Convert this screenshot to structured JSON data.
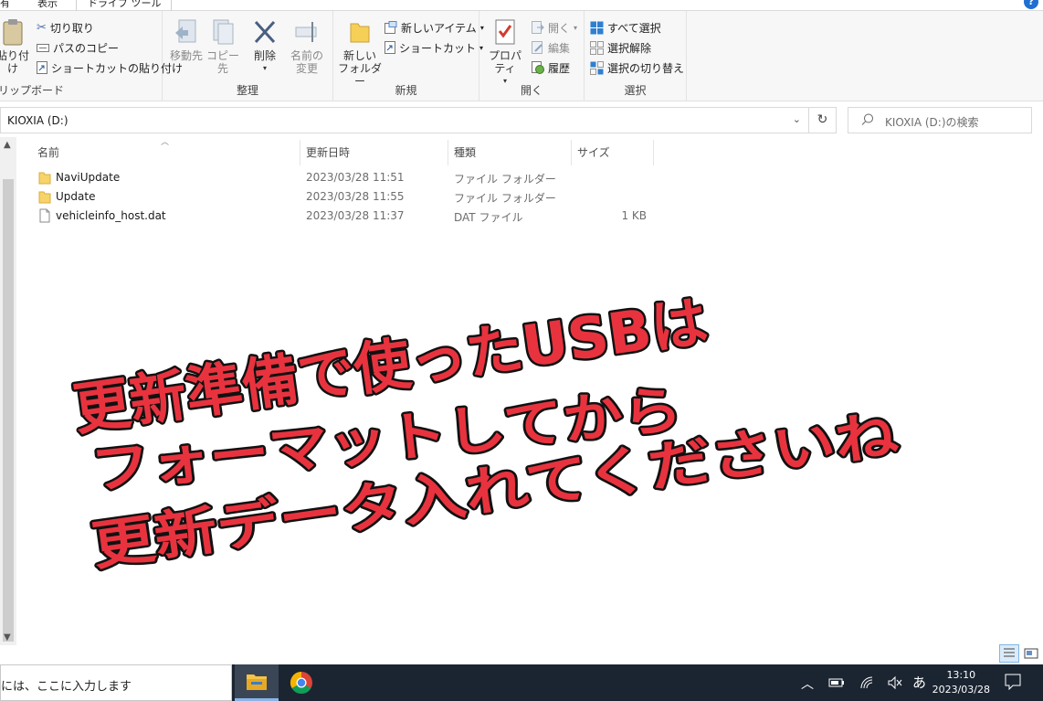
{
  "tabs": {
    "file": "有",
    "view": "表示",
    "drive_tools": "ドライブ ツール"
  },
  "ribbon": {
    "clipboard": {
      "label": "リップボード",
      "paste": "貼り付け",
      "cut": "切り取り",
      "copy_path": "パスのコピー",
      "paste_shortcut": "ショートカットの貼り付け"
    },
    "organize": {
      "label": "整理",
      "move_to": "移動先",
      "copy_to": "コピー先",
      "delete": "削除",
      "rename_1": "名前の",
      "rename_2": "変更"
    },
    "new": {
      "label": "新規",
      "new_folder_1": "新しい",
      "new_folder_2": "フォルダー",
      "new_item": "新しいアイテム",
      "shortcut": "ショートカット"
    },
    "open": {
      "label": "開く",
      "properties": "プロパティ",
      "open": "開く",
      "edit": "編集",
      "history": "履歴"
    },
    "select": {
      "label": "選択",
      "select_all": "すべて選択",
      "select_none": "選択解除",
      "invert": "選択の切り替え"
    }
  },
  "address": {
    "path": "KIOXIA (D:)",
    "search_placeholder": "KIOXIA (D:)の検索"
  },
  "columns": {
    "name": "名前",
    "modified": "更新日時",
    "type": "種類",
    "size": "サイズ"
  },
  "files": [
    {
      "name": "NaviUpdate",
      "modified": "2023/03/28 11:51",
      "type": "ファイル フォルダー",
      "size": "",
      "icon": "folder-icon"
    },
    {
      "name": "Update",
      "modified": "2023/03/28 11:55",
      "type": "ファイル フォルダー",
      "size": "",
      "icon": "folder-icon"
    },
    {
      "name": "vehicleinfo_host.dat",
      "modified": "2023/03/28 11:37",
      "type": "DAT ファイル",
      "size": "1 KB",
      "icon": "file-icon"
    }
  ],
  "overlay": {
    "line1": "更新準備で使ったUSBは",
    "line2": "フォーマットしてから",
    "line3": "更新データ入れてくださいね",
    "fill_color": "#e8333f",
    "outline_color": "#111111"
  },
  "taskbar": {
    "search_text": "には、ここに入力します",
    "ime": "あ",
    "time": "13:10",
    "date": "2023/03/28"
  }
}
